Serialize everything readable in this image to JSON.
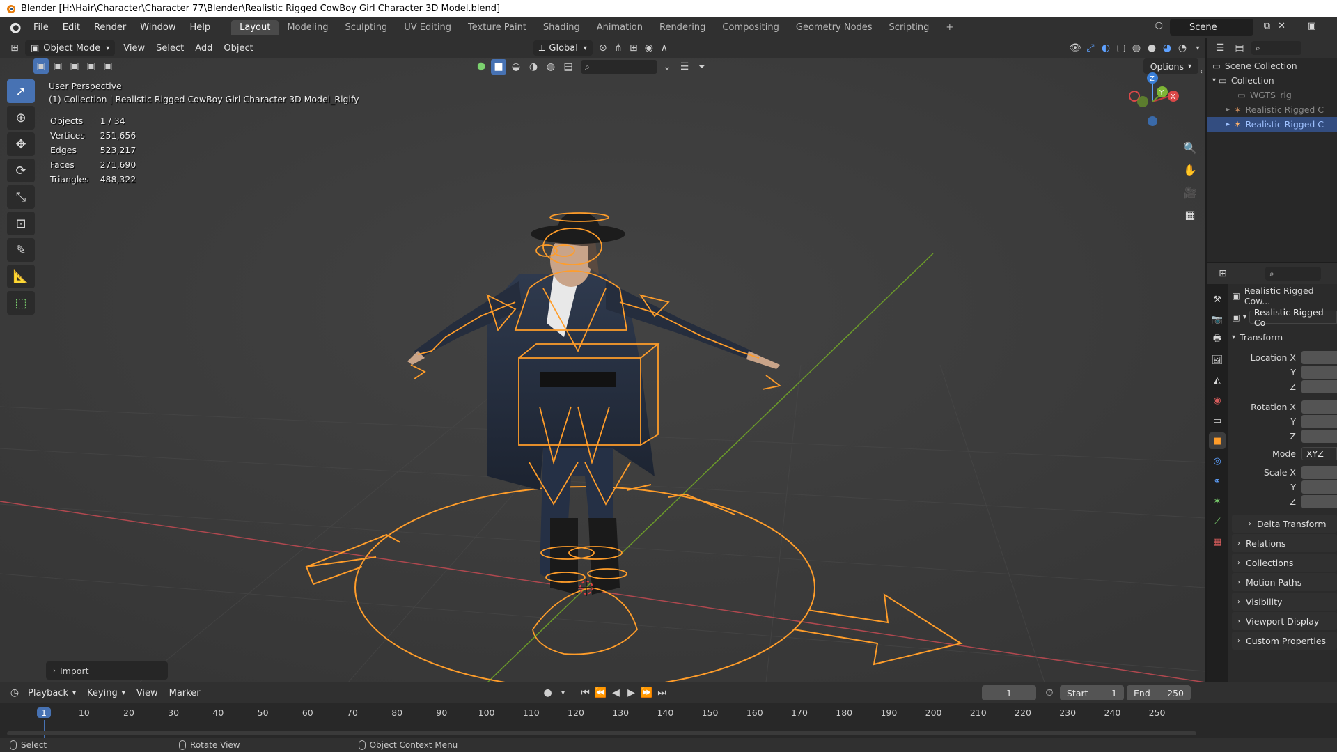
{
  "window": {
    "title": "Blender [H:\\Hair\\Character\\Character 77\\Blender\\Realistic Rigged CowBoy Girl Character 3D Model.blend]"
  },
  "menubar": {
    "menus": [
      "File",
      "Edit",
      "Render",
      "Window",
      "Help"
    ],
    "workspaces": [
      "Layout",
      "Modeling",
      "Sculpting",
      "UV Editing",
      "Texture Paint",
      "Shading",
      "Animation",
      "Rendering",
      "Compositing",
      "Geometry Nodes",
      "Scripting"
    ],
    "active_workspace": "Layout",
    "scene": "Scene"
  },
  "viewport_header": {
    "mode": "Object Mode",
    "menus": [
      "View",
      "Select",
      "Add",
      "Object"
    ],
    "transform_orientation": "Global",
    "options_label": "Options"
  },
  "viewport": {
    "perspective": "User Perspective",
    "collection_info": "(1) Collection | Realistic Rigged CowBoy Girl Character 3D Model_Rigify",
    "stats": [
      {
        "label": "Objects",
        "value": "1 / 34"
      },
      {
        "label": "Vertices",
        "value": "251,656"
      },
      {
        "label": "Edges",
        "value": "523,217"
      },
      {
        "label": "Faces",
        "value": "271,690"
      },
      {
        "label": "Triangles",
        "value": "488,322"
      }
    ],
    "gizmo_axes": {
      "x": "X",
      "y": "Y",
      "z": "Z"
    },
    "import_panel": "Import"
  },
  "outliner": {
    "rows": [
      {
        "label": "Scene Collection",
        "state": "normal"
      },
      {
        "label": "Collection",
        "state": "normal"
      },
      {
        "label": "WGTS_rig",
        "state": "dim"
      },
      {
        "label": "Realistic Rigged C",
        "state": "dim"
      },
      {
        "label": "Realistic Rigged C",
        "state": "selected"
      }
    ]
  },
  "properties": {
    "object_name": "Realistic Rigged Cow...",
    "data_name": "Realistic Rigged Co",
    "transform_label": "Transform",
    "location": {
      "x": "Location X",
      "y": "Y",
      "z": "Z"
    },
    "rotation": {
      "x": "Rotation X",
      "y": "Y",
      "z": "Z"
    },
    "mode_label": "Mode",
    "mode_value": "XYZ",
    "scale": {
      "x": "Scale X",
      "y": "Y",
      "z": "Z"
    },
    "panels": [
      "Delta Transform",
      "Relations",
      "Collections",
      "Motion Paths",
      "Visibility",
      "Viewport Display",
      "Custom Properties"
    ]
  },
  "timeline": {
    "menus": [
      "Playback",
      "Keying",
      "View",
      "Marker"
    ],
    "current_frame": "1",
    "start_label": "Start",
    "start_value": "1",
    "end_label": "End",
    "end_value": "250",
    "ticks": [
      "1",
      "10",
      "20",
      "30",
      "40",
      "50",
      "60",
      "70",
      "80",
      "90",
      "100",
      "110",
      "120",
      "130",
      "140",
      "150",
      "160",
      "170",
      "180",
      "190",
      "200",
      "210",
      "220",
      "230",
      "240",
      "250"
    ]
  },
  "statusbar": {
    "select": "Select",
    "rotate": "Rotate View",
    "context": "Object Context Menu"
  },
  "colors": {
    "accent": "#4772b3",
    "rig": "#ff9d2a",
    "axis_x": "#c43c3c",
    "axis_y": "#6b9a2a"
  }
}
